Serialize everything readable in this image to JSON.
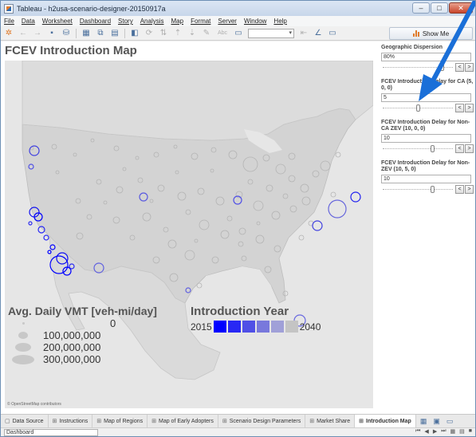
{
  "window": {
    "title": "Tableau - h2usa-scenario-designer-20150917a",
    "buttons": [
      "–",
      "□",
      "✕"
    ]
  },
  "menu": [
    "File",
    "Data",
    "Worksheet",
    "Dashboard",
    "Story",
    "Analysis",
    "Map",
    "Format",
    "Server",
    "Window",
    "Help"
  ],
  "toolbar": {
    "show_me": "Show Me",
    "abc_label": "Abc"
  },
  "sheet": {
    "title": "FCEV Introduction Map"
  },
  "parameters": [
    {
      "title": "Geographic Dispersion",
      "value": "80%",
      "level": 0.86
    },
    {
      "title": "FCEV Introduction Delay for CA (5, 0, 0)",
      "value": "5",
      "level": 0.5
    },
    {
      "title": "FCEV Introduction Delay for Non-CA ZEV (10, 0, 0)",
      "value": "10",
      "level": 0.72
    },
    {
      "title": "FCEV Introduction Delay for Non-ZEV (10, 5, 0)",
      "value": "10",
      "level": 0.72
    }
  ],
  "legend_vmt": {
    "title": "Avg. Daily VMT [veh-mi/day]",
    "values": [
      "0",
      "100,000,000",
      "200,000,000",
      "300,000,000"
    ]
  },
  "legend_year": {
    "title": "Introduction Year",
    "start": "2015",
    "end": "2040",
    "colors": [
      "#0000ff",
      "#2828f4",
      "#5050e6",
      "#7878dc",
      "#a0a0d8",
      "#c4c4c4"
    ]
  },
  "map": {
    "attribution": "© OpenStreetMap contributors"
  },
  "tabs": [
    {
      "label": "Data Source",
      "icon": "database-icon"
    },
    {
      "label": "Instructions",
      "icon": "dashboard-icon"
    },
    {
      "label": "Map of Regions",
      "icon": "dashboard-icon"
    },
    {
      "label": "Map of Early Adopters",
      "icon": "dashboard-icon"
    },
    {
      "label": "Scenario Design Parameters",
      "icon": "dashboard-icon"
    },
    {
      "label": "Market Share",
      "icon": "dashboard-icon"
    },
    {
      "label": "Introduction Map",
      "icon": "dashboard-icon",
      "active": true
    }
  ],
  "status": {
    "sheet": "Dashboard"
  }
}
